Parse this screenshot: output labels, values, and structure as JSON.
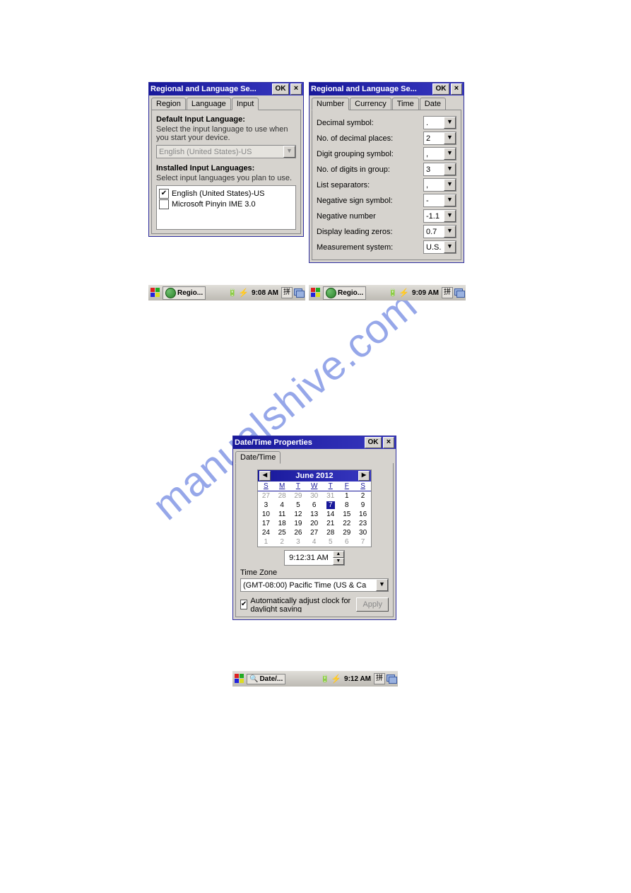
{
  "watermark": "manualshive.com",
  "window1": {
    "title": "Regional and Language Se...",
    "ok": "OK",
    "tabs": [
      "Region",
      "Language",
      "Input"
    ],
    "activeTab": 2,
    "defaultHeading": "Default Input Language:",
    "defaultDesc": "Select the input language to use when you start your device.",
    "defaultValue": "English (United States)-US",
    "installedHeading": "Installed Input Languages:",
    "installedDesc": "Select input languages you plan to use.",
    "languages": [
      {
        "label": "English (United States)-US",
        "checked": true
      },
      {
        "label": "Microsoft Pinyin IME 3.0",
        "checked": false
      }
    ],
    "taskbar": {
      "app": "Regio...",
      "time": "9:08 AM",
      "ime": "拼"
    }
  },
  "window2": {
    "title": "Regional and Language Se...",
    "ok": "OK",
    "tabs": [
      "Number",
      "Currency",
      "Time",
      "Date"
    ],
    "activeTab": 0,
    "rows": [
      {
        "label": "Decimal symbol:",
        "value": "."
      },
      {
        "label": "No. of decimal places:",
        "value": "2"
      },
      {
        "label": "Digit grouping symbol:",
        "value": ","
      },
      {
        "label": "No. of digits in group:",
        "value": "3"
      },
      {
        "label": "List separators:",
        "value": ","
      },
      {
        "label": "Negative sign symbol:",
        "value": "-"
      },
      {
        "label": "Negative number",
        "value": "-1.1"
      },
      {
        "label": "Display leading zeros:",
        "value": "0.7"
      },
      {
        "label": "Measurement system:",
        "value": "U.S."
      }
    ],
    "taskbar": {
      "app": "Regio...",
      "time": "9:09 AM",
      "ime": "拼"
    }
  },
  "window3": {
    "title": "Date/Time Properties",
    "ok": "OK",
    "tab": "Date/Time",
    "calendar": {
      "month": "June 2012",
      "dow": [
        "S",
        "M",
        "T",
        "W",
        "T",
        "F",
        "S"
      ],
      "weeks": [
        [
          {
            "d": "27",
            "dim": true
          },
          {
            "d": "28",
            "dim": true
          },
          {
            "d": "29",
            "dim": true
          },
          {
            "d": "30",
            "dim": true
          },
          {
            "d": "31",
            "dim": true
          },
          {
            "d": "1"
          },
          {
            "d": "2"
          }
        ],
        [
          {
            "d": "3"
          },
          {
            "d": "4"
          },
          {
            "d": "5"
          },
          {
            "d": "6"
          },
          {
            "d": "7",
            "sel": true
          },
          {
            "d": "8"
          },
          {
            "d": "9"
          }
        ],
        [
          {
            "d": "10"
          },
          {
            "d": "11"
          },
          {
            "d": "12"
          },
          {
            "d": "13"
          },
          {
            "d": "14"
          },
          {
            "d": "15"
          },
          {
            "d": "16"
          }
        ],
        [
          {
            "d": "17"
          },
          {
            "d": "18"
          },
          {
            "d": "19"
          },
          {
            "d": "20"
          },
          {
            "d": "21"
          },
          {
            "d": "22"
          },
          {
            "d": "23"
          }
        ],
        [
          {
            "d": "24"
          },
          {
            "d": "25"
          },
          {
            "d": "26"
          },
          {
            "d": "27"
          },
          {
            "d": "28"
          },
          {
            "d": "29"
          },
          {
            "d": "30"
          }
        ],
        [
          {
            "d": "1",
            "dim": true
          },
          {
            "d": "2",
            "dim": true
          },
          {
            "d": "3",
            "dim": true
          },
          {
            "d": "4",
            "dim": true
          },
          {
            "d": "5",
            "dim": true
          },
          {
            "d": "6",
            "dim": true
          },
          {
            "d": "7",
            "dim": true
          }
        ]
      ]
    },
    "time": "9:12:31 AM",
    "timezoneLabel": "Time Zone",
    "timezone": "(GMT-08:00) Pacific Time (US & Ca",
    "autoAdjust": "Automatically adjust clock for daylight saving",
    "apply": "Apply",
    "taskbar": {
      "app": "Date/...",
      "time": "9:12 AM",
      "ime": "拼"
    }
  }
}
